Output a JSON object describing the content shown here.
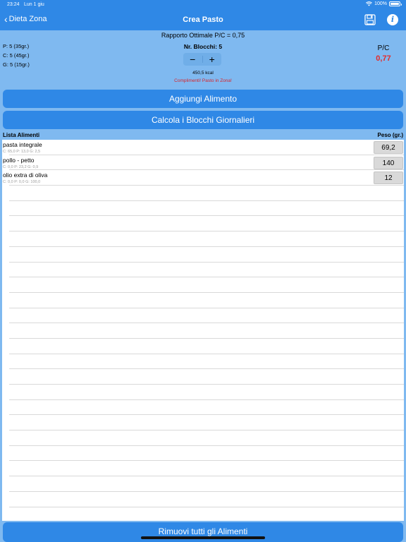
{
  "status_bar": {
    "time": "23:24",
    "date": "Lun 1 giu",
    "battery": "100%"
  },
  "nav": {
    "back_label": "Dieta Zona",
    "title": "Crea Pasto",
    "back_icon": "chevron-left-icon",
    "save_icon": "floppy-disk-icon",
    "info_icon": "info-icon"
  },
  "summary": {
    "ratio_text": "Rapporto Ottimale P/C = 0,75",
    "blocks_text": "Nr. Blocchi: 5",
    "protein": "P: 5 (35gr.)",
    "carbs": "C: 5 (45gr.)",
    "fat": "G: 5 (15gr.)",
    "minus": "−",
    "plus": "+",
    "kcal": "450,5 kcal",
    "zone_message": "Complimenti! Pasto in Zona!",
    "pc_label": "P/C",
    "pc_value": "0,77"
  },
  "buttons": {
    "add_food": "Aggiungi Alimento",
    "calc_blocks": "Calcola i Blocchi Giornalieri",
    "remove_all": "Rimuovi tutti gli Alimenti"
  },
  "list": {
    "header_left": "Lista Alimenti",
    "header_right": "Peso (gr.)",
    "items": [
      {
        "name": "pasta integrale",
        "macros": "C:  65,0   P:  13,0   G:  2,5",
        "weight": "69,2"
      },
      {
        "name": "pollo - petto",
        "macros": "C:  0,0   P:  23,2   G:  0,9",
        "weight": "140"
      },
      {
        "name": "olio extra di oliva",
        "macros": "C:  0,0   P:  0,0   G:  100,0",
        "weight": "12"
      }
    ]
  },
  "colors": {
    "nav_blue": "#2f88e6",
    "background": "#7fb9f0",
    "accent_red": "#e52a2a"
  }
}
